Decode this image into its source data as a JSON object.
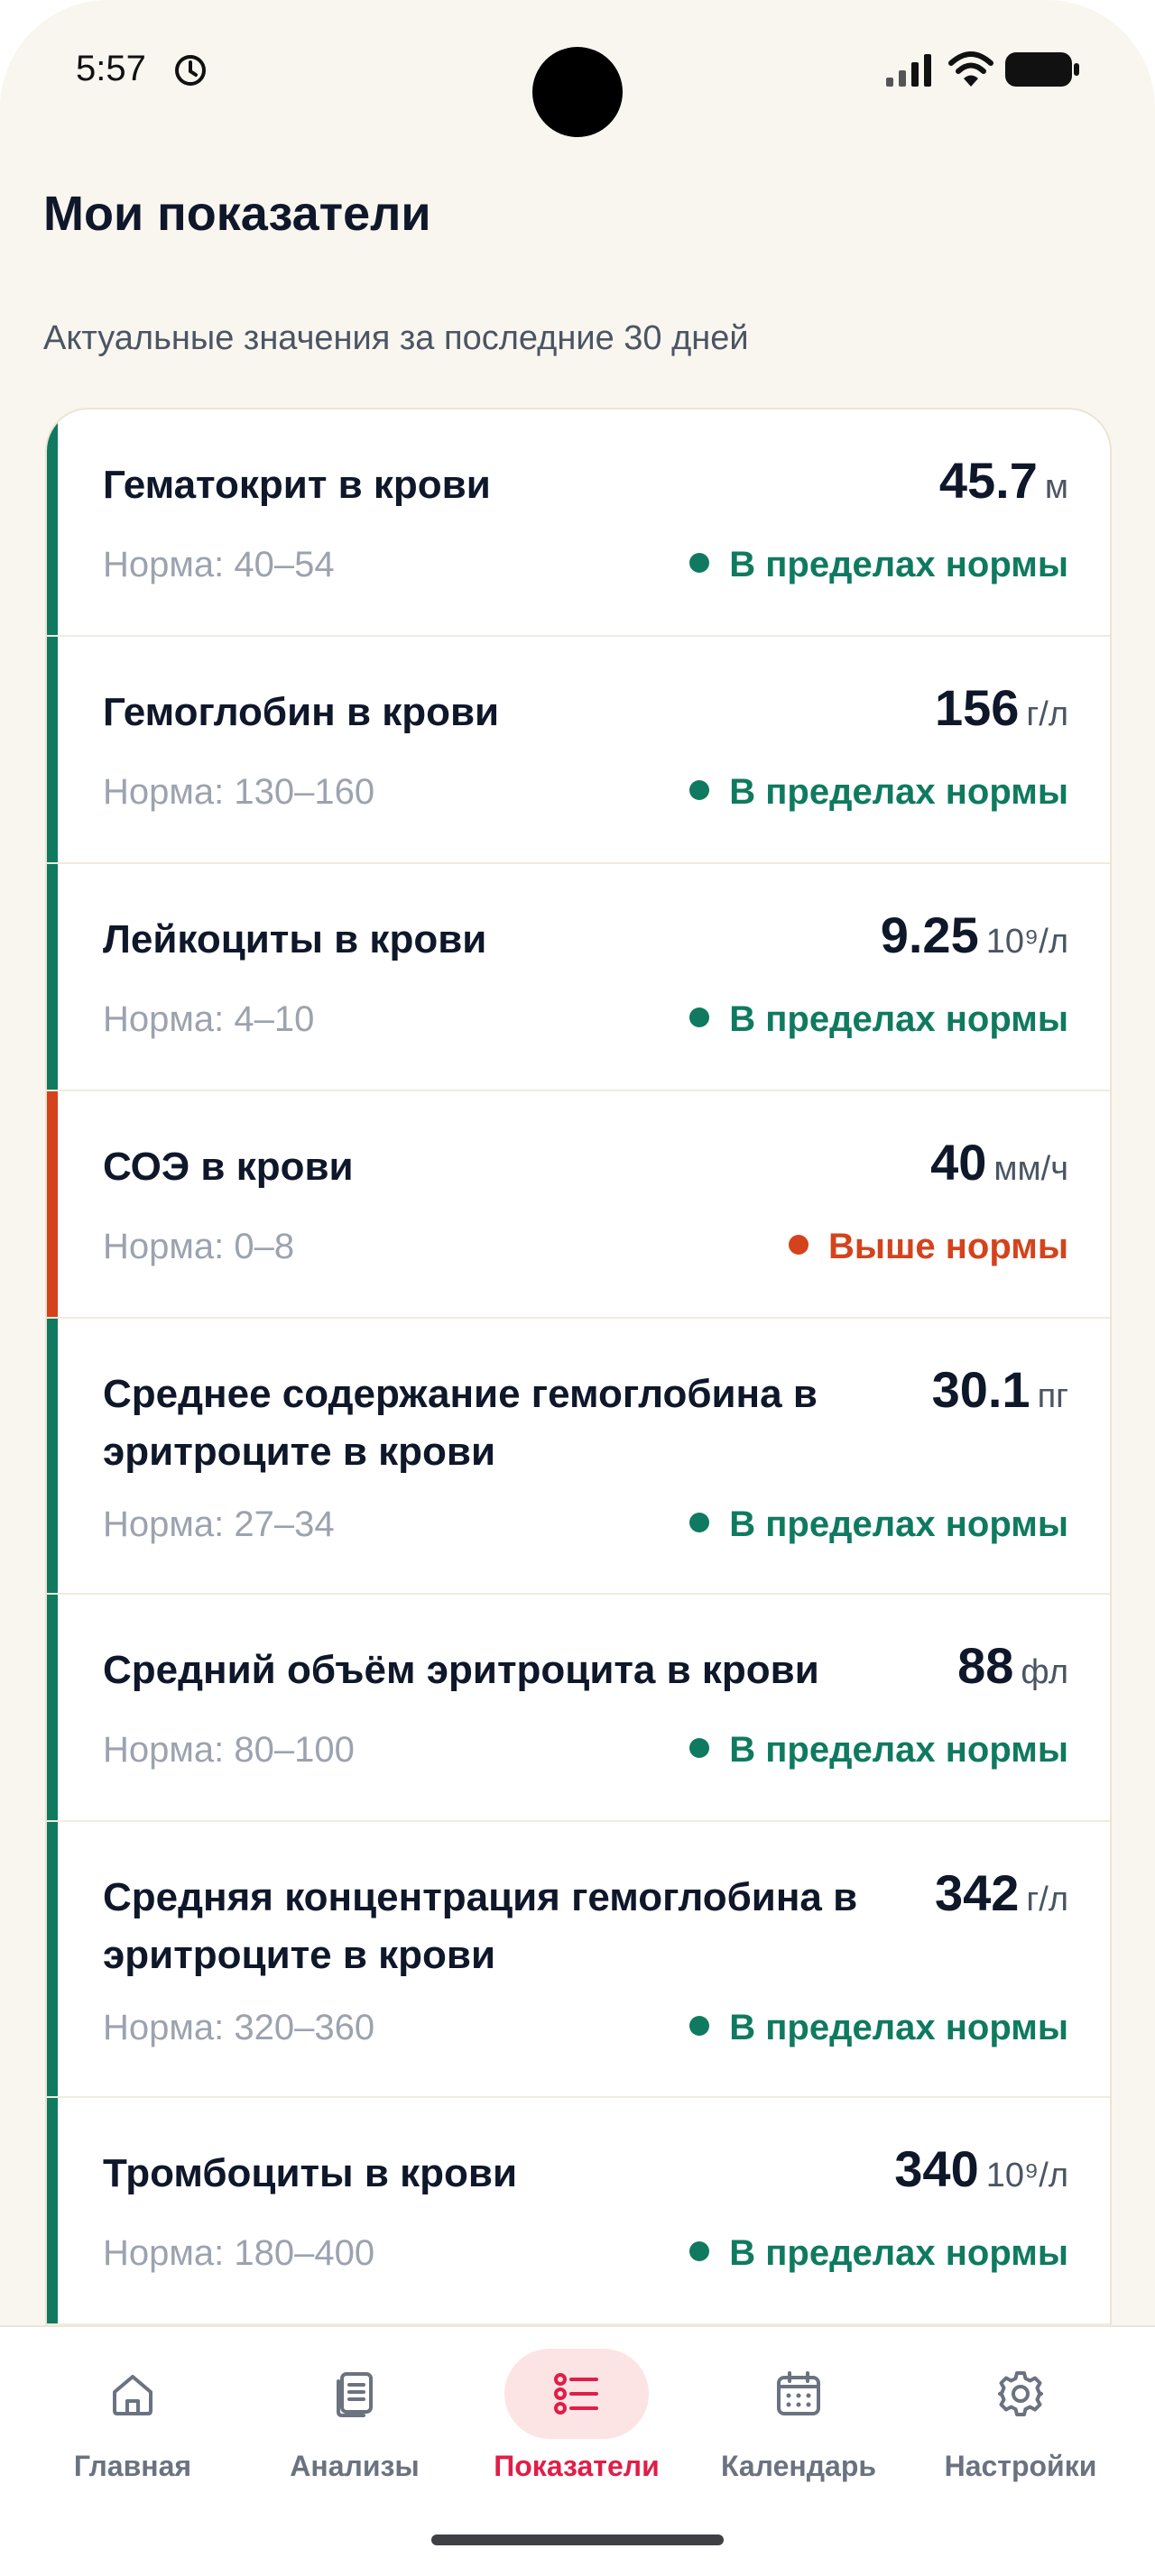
{
  "status_bar": {
    "time": "5:57"
  },
  "page": {
    "title": "Мои показатели",
    "subtitle": "Актуальные значения за последние 30 дней"
  },
  "colors": {
    "normal": "#0f7a5f",
    "high": "#d4431c",
    "active_nav": "#e11d48"
  },
  "indicators": [
    {
      "name": "Гематокрит в крови",
      "value": "45.7",
      "unit": "м",
      "norm": "Норма: 40–54",
      "status": "В пределах нормы",
      "state": "normal"
    },
    {
      "name": "Гемоглобин в крови",
      "value": "156",
      "unit": "г/л",
      "norm": "Норма: 130–160",
      "status": "В пределах нормы",
      "state": "normal"
    },
    {
      "name": "Лейкоциты в крови",
      "value": "9.25",
      "unit": "10⁹/л",
      "norm": "Норма: 4–10",
      "status": "В пределах нормы",
      "state": "normal"
    },
    {
      "name": "СОЭ в крови",
      "value": "40",
      "unit": "мм/ч",
      "norm": "Норма: 0–8",
      "status": "Выше нормы",
      "state": "high"
    },
    {
      "name": "Среднее содержание гемоглобина в эритроците в крови",
      "value": "30.1",
      "unit": "пг",
      "norm": "Норма: 27–34",
      "status": "В пределах нормы",
      "state": "normal"
    },
    {
      "name": "Средний объём эритроцита в крови",
      "value": "88",
      "unit": "фл",
      "norm": "Норма: 80–100",
      "status": "В пределах нормы",
      "state": "normal"
    },
    {
      "name": "Средняя концентрация гемоглобина в эритроците в крови",
      "value": "342",
      "unit": "г/л",
      "norm": "Норма: 320–360",
      "status": "В пределах нормы",
      "state": "normal"
    },
    {
      "name": "Тромбоциты в крови",
      "value": "340",
      "unit": "10⁹/л",
      "norm": "Норма: 180–400",
      "status": "В пределах нормы",
      "state": "normal"
    }
  ],
  "nav": {
    "items": [
      {
        "label": "Главная",
        "icon": "home-icon"
      },
      {
        "label": "Анализы",
        "icon": "documents-icon"
      },
      {
        "label": "Показатели",
        "icon": "list-icon",
        "active": true
      },
      {
        "label": "Календарь",
        "icon": "calendar-icon"
      },
      {
        "label": "Настройки",
        "icon": "gear-icon"
      }
    ]
  }
}
